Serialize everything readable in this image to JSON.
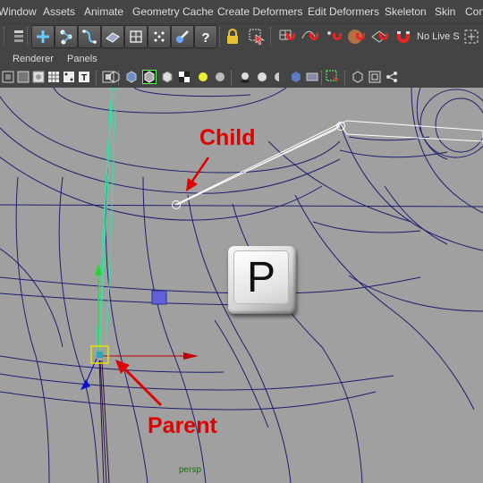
{
  "menu": [
    "Window",
    "Assets",
    "Animate",
    "Geometry Cache",
    "Create Deformers",
    "Edit Deformers",
    "Skeleton",
    "Skin",
    "Con"
  ],
  "shelf": {
    "live_label": "No Live S",
    "tools": [
      "layer-lock-icon",
      "create-joint-icon",
      "ik-handle-icon",
      "ik-spline-icon",
      "lattice-icon",
      "cluster-icon",
      "cv-grid-icon",
      "paint-weights-icon",
      "help-icon",
      "lock-icon",
      "select-tool-icon",
      "snap-grid-icon",
      "snap-curve-icon",
      "snap-point-icon",
      "snap-view-icon",
      "snap-surface-icon",
      "magnet-icon"
    ]
  },
  "panel_menus": [
    "Renderer",
    "Panels"
  ],
  "viewport": {
    "camera_label": "persp",
    "hotkey": "P",
    "callouts": {
      "child": "Child",
      "parent": "Parent"
    }
  },
  "colors": {
    "ui_bg": "#444444",
    "viewport_bg": "#a0a0a0",
    "wireframe": "#1e1e6e",
    "callout": "#e00000",
    "selected_bone": "#37e0a0",
    "camera_label": "#1a6a1a"
  }
}
